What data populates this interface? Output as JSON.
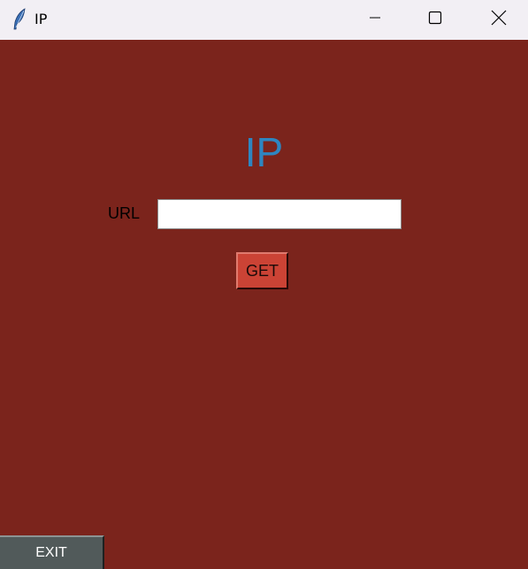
{
  "window": {
    "title": "IP",
    "minimize_icon": "minimize-icon",
    "maximize_icon": "maximize-icon",
    "close_icon": "close-icon",
    "app_icon": "feather-icon"
  },
  "main": {
    "heading": "IP",
    "url_label": "URL",
    "url_value": "",
    "get_label": "GET",
    "exit_label": "EXIT"
  },
  "colors": {
    "background": "#7b241c",
    "heading": "#2e86c1",
    "get_button": "#cb4335",
    "exit_button": "#515a5a",
    "titlebar": "#f2eff4"
  }
}
